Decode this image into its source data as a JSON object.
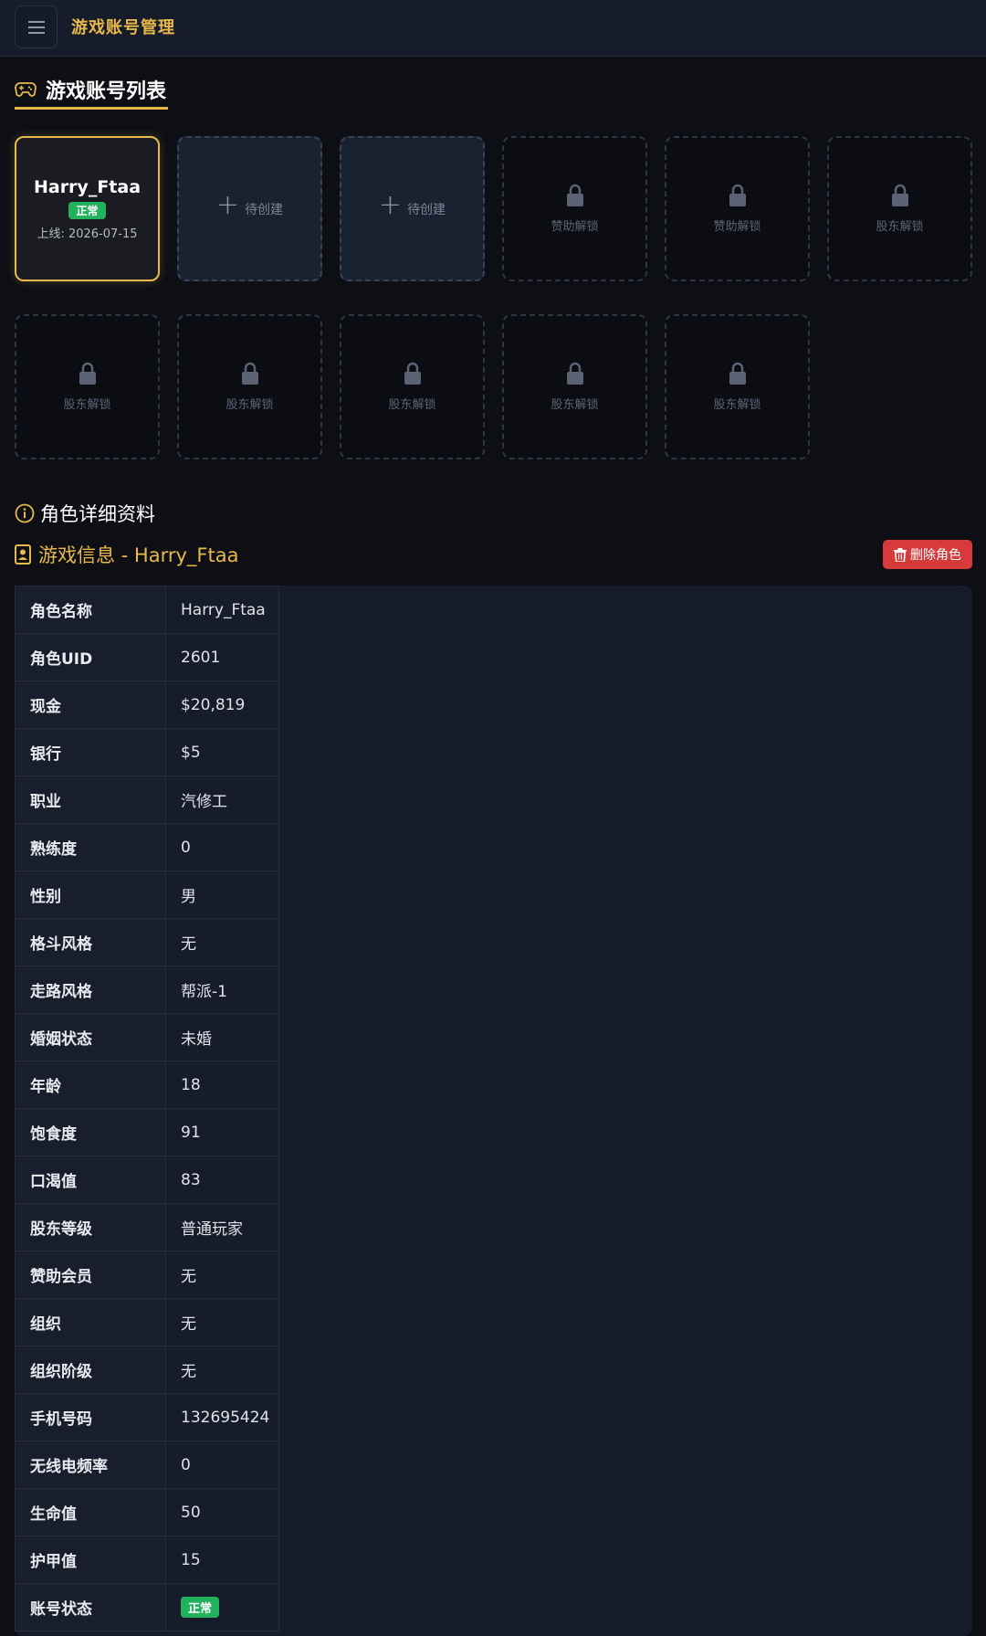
{
  "app": {
    "title": "游戏账号管理"
  },
  "section": {
    "title": "游戏账号列表"
  },
  "cards": {
    "active": {
      "name": "Harry_Ftaa",
      "badge": "正常",
      "online": "上线: 2026-07-15"
    },
    "create_label": "待创建",
    "sponsor_label": "赞助解锁",
    "shareholder_label": "股东解锁"
  },
  "detail": {
    "heading": "角色详细资料",
    "game_info": "游戏信息 - Harry_Ftaa",
    "delete_label": "删除角色"
  },
  "info_rows": [
    {
      "k": "角色名称",
      "v": "Harry_Ftaa"
    },
    {
      "k": "角色UID",
      "v": "2601"
    },
    {
      "k": "现金",
      "v": "$20,819"
    },
    {
      "k": "银行",
      "v": "$5"
    },
    {
      "k": "职业",
      "v": "汽修工"
    },
    {
      "k": "熟练度",
      "v": "0"
    },
    {
      "k": "性别",
      "v": "男"
    },
    {
      "k": "格斗风格",
      "v": "无"
    },
    {
      "k": "走路风格",
      "v": "帮派-1"
    },
    {
      "k": "婚姻状态",
      "v": "未婚"
    },
    {
      "k": "年龄",
      "v": "18"
    },
    {
      "k": "饱食度",
      "v": "91"
    },
    {
      "k": "口渴值",
      "v": "83"
    },
    {
      "k": "股东等级",
      "v": "普通玩家"
    },
    {
      "k": "赞助会员",
      "v": "无"
    },
    {
      "k": "组织",
      "v": "无"
    },
    {
      "k": "组织阶级",
      "v": "无"
    },
    {
      "k": "手机号码",
      "v": "132695424"
    },
    {
      "k": "无线电频率",
      "v": "0"
    },
    {
      "k": "生命值",
      "v": "50"
    },
    {
      "k": "护甲值",
      "v": "15"
    },
    {
      "k": "账号状态",
      "v": "正常"
    }
  ],
  "colors": {
    "accent": "#e8b94a",
    "success": "#22b15c",
    "danger": "#d63a3a"
  }
}
